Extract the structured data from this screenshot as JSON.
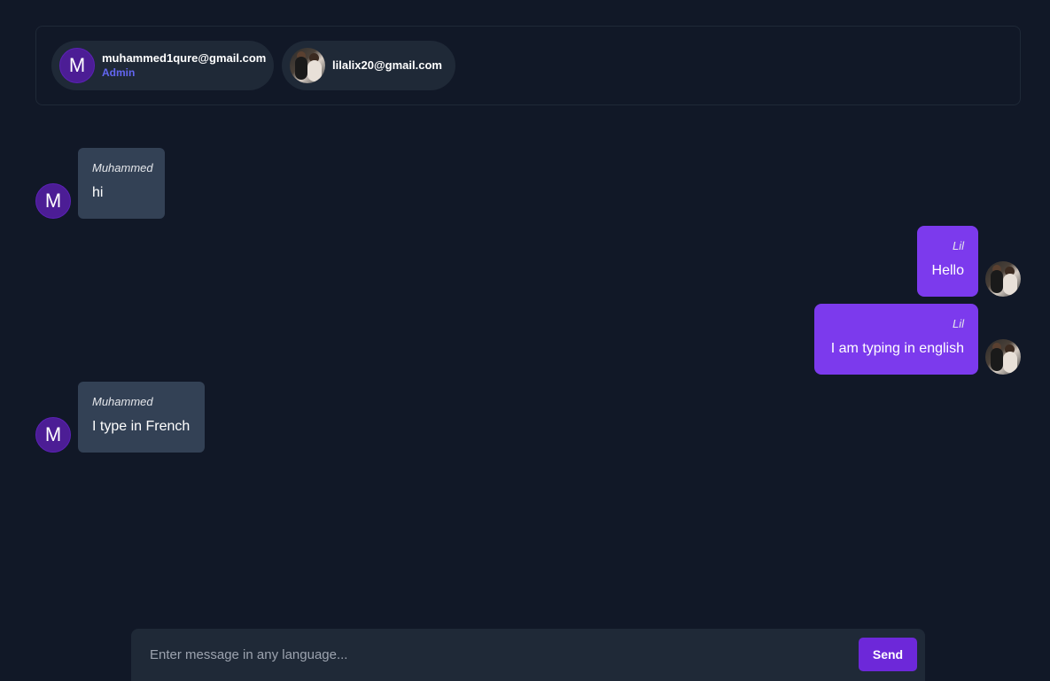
{
  "participants": [
    {
      "avatar_letter": "M",
      "email": "muhammed1qure@gmail.com",
      "role": "Admin"
    },
    {
      "avatar_icon": "user-photo",
      "email": "lilalix20@gmail.com"
    }
  ],
  "messages": [
    {
      "side": "left",
      "avatar_letter": "M",
      "sender": "Muhammed",
      "text": "hi"
    },
    {
      "side": "right",
      "avatar_icon": "user-photo",
      "sender": "Lil",
      "text": "Hello"
    },
    {
      "side": "right",
      "avatar_icon": "user-photo",
      "sender": "Lil",
      "text": "I am typing in english"
    },
    {
      "side": "left",
      "avatar_letter": "M",
      "sender": "Muhammed",
      "text": "I type in French"
    }
  ],
  "composer": {
    "placeholder": "Enter message in any language...",
    "value": "",
    "send_label": "Send"
  },
  "colors": {
    "background": "#111827",
    "received_bubble": "#334155",
    "sent_bubble": "#7c3aed",
    "accent": "#6d28d9",
    "role_text": "#6366f1"
  }
}
